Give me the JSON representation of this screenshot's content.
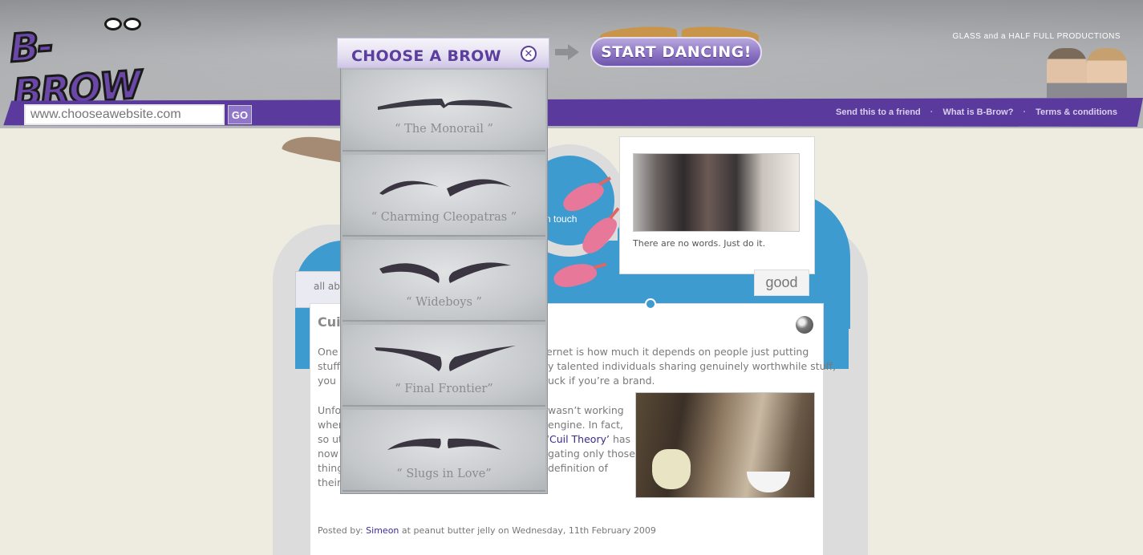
{
  "header": {
    "logo_text": "B-BROW",
    "url_input_placeholder": "www.chooseawebsite.com",
    "go_label": "GO",
    "start_dancing_label": "START DANCING!",
    "company_logo": "GLASS and a HALF FULL PRODUCTIONS",
    "links": [
      {
        "label": "Send this to a friend"
      },
      {
        "label": "What is B-Brow?"
      },
      {
        "label": "Terms & conditions"
      }
    ],
    "link_separator": "·"
  },
  "brow_chooser": {
    "title": "CHOOSE A BROW",
    "close_icon": "close-icon",
    "options": [
      {
        "label": "“ The Monorail ”"
      },
      {
        "label": "“ Charming Cleopatras ”"
      },
      {
        "label": "“ Wideboys ”"
      },
      {
        "label": "“ Final Frontier”"
      },
      {
        "label": "“ Slugs in Love”"
      }
    ]
  },
  "content": {
    "all_about_text": "all abo",
    "touch_text": "n touch",
    "photo_caption": "There are no words. Just do it.",
    "good_tag": "good",
    "article_title": "Cuil",
    "paragraph_1": [
      "One c",
      "ernet is how much it depends on people just putting",
      "stuff",
      "y talented individuals sharing genuinely worthwhile stuff,",
      "you b",
      "uck if you’re a brand."
    ],
    "paragraph_2": [
      "Unfor",
      "wasn’t working",
      "when",
      "engine. In fact,",
      "so ut",
      "‘Cuil Theory’",
      "has",
      "now a",
      "gating only those",
      "thing",
      "definition of",
      "their"
    ],
    "posted_by_prefix": "Posted by:",
    "posted_by_author": "Simeon",
    "posted_by_suffix": "at peanut butter jelly on Wednesday, 11th February 2009"
  },
  "colors": {
    "brand_purple": "#5a3a9c",
    "accent_blue": "#3d9bcf",
    "page_bg": "#eeece0"
  }
}
